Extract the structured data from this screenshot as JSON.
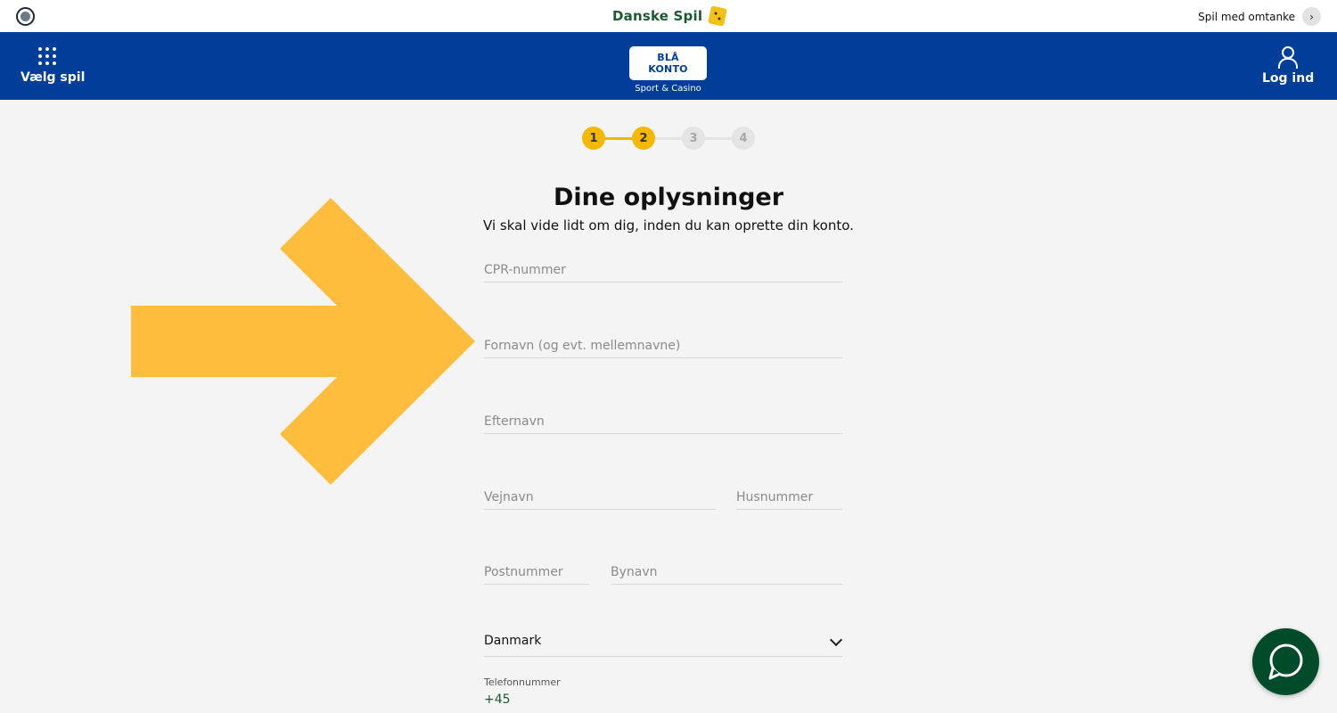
{
  "topbar": {
    "brand_name": "Danske Spil",
    "mindful_play": "Spil med omtanke"
  },
  "header": {
    "choose_games": "Vælg spil",
    "account_badge": "BLÅ KONTO",
    "account_sub": "Sport & Casino",
    "login": "Log ind"
  },
  "stepper": {
    "steps": [
      {
        "label": "1",
        "state": "active"
      },
      {
        "label": "2",
        "state": "active"
      },
      {
        "label": "3",
        "state": "inactive"
      },
      {
        "label": "4",
        "state": "inactive"
      }
    ],
    "active_color": "#f5b800",
    "inactive_color": "#e4e4e4"
  },
  "form": {
    "title": "Dine oplysninger",
    "subtitle": "Vi skal vide lidt om dig, inden du kan oprette din konto.",
    "cpr_placeholder": "CPR-nummer",
    "first_name_placeholder": "Fornavn (og evt. mellemnavne)",
    "last_name_placeholder": "Efternavn",
    "street_placeholder": "Vejnavn",
    "house_number_placeholder": "Husnummer",
    "postal_code_placeholder": "Postnummer",
    "city_placeholder": "Bynavn",
    "country_value": "Danmark",
    "phone_label": "Telefonnummer",
    "phone_prefix": "+45"
  },
  "colors": {
    "header_blue": "#003e99",
    "brand_green": "#1b5b2e",
    "arrow_yellow": "#ffbd3d",
    "chat_green": "#004b2a"
  },
  "icons": {
    "seal": "royal-seal-icon",
    "brand": "danske-spil-logo-icon",
    "grid": "grid-dots-icon",
    "user": "user-icon",
    "chevron": "chevron-down-icon",
    "chat": "chat-bubble-icon",
    "arrow": "right-arrow-overlay"
  }
}
